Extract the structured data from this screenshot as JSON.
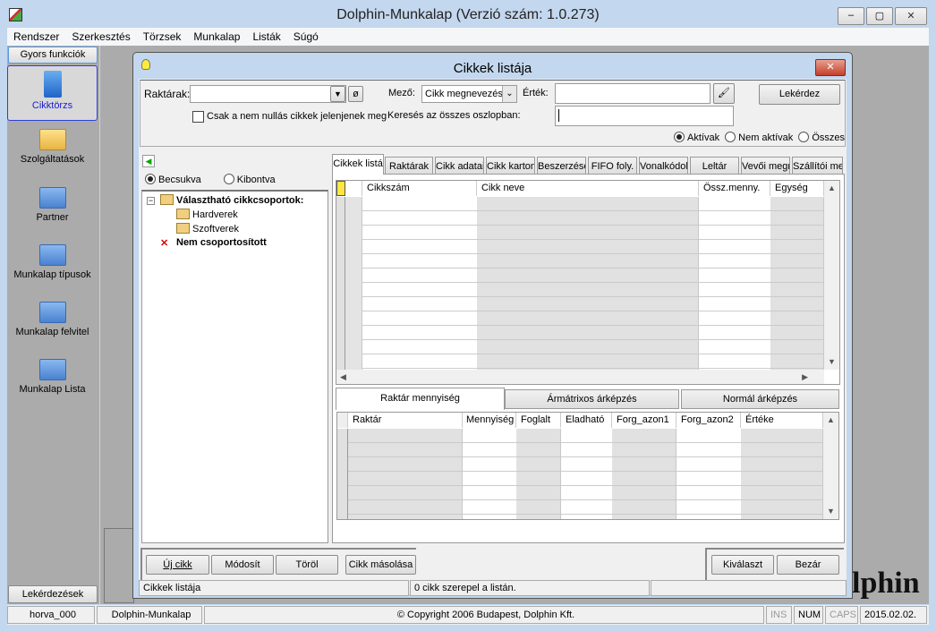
{
  "window": {
    "title": "Dolphin-Munkalap  (Verzió szám: 1.0.273)"
  },
  "menu": [
    "Rendszer",
    "Szerkesztés",
    "Törzsek",
    "Munkalap",
    "Listák",
    "Súgó"
  ],
  "sidebar": {
    "header": "Gyors funkciók",
    "items": [
      {
        "label": "Cikktörzs",
        "active": true
      },
      {
        "label": "Szolgáltatások"
      },
      {
        "label": "Partner"
      },
      {
        "label": "Munkalap típusok"
      },
      {
        "label": "Munkalap felvitel"
      },
      {
        "label": "Munkalap Lista"
      }
    ],
    "footer": "Lekérdezések"
  },
  "dialog": {
    "title": "Cikkek listája",
    "filters": {
      "raktarak_label": "Raktárak:",
      "raktarak_value": "",
      "clear_symbol": "ø",
      "nonzero_label": "Csak a nem nullás cikkek jelenjenek meg",
      "nonzero_checked": false,
      "mezo_label": "Mező:",
      "mezo_value": "Cikk megnevezése",
      "ertek_label": "Érték:",
      "ertek_value": "",
      "search_all_label": "Keresés az összes oszlopban:",
      "search_all_value": "",
      "query_button": "Lekérdez",
      "status_options": [
        "Aktívak",
        "Nem aktívak",
        "Összes"
      ],
      "status_selected": "Aktívak"
    },
    "tree": {
      "mode_options": [
        "Becsukva",
        "Kibontva"
      ],
      "mode_selected": "Becsukva",
      "root": "Választható cikkcsoportok:",
      "children": [
        "Hardverek",
        "Szoftverek"
      ],
      "ungrouped": "Nem csoportosított"
    },
    "tabs": [
      "Cikkek listá",
      "Raktárak",
      "Cikk adatai",
      "Cikk karton",
      "Beszerzése",
      "FIFO foly.",
      "Vonalkódok",
      "Leltár",
      "Vevői megr",
      "Szállítói meg"
    ],
    "grid": {
      "columns": [
        "Cikkszám",
        "Cikk neve",
        "Össz.menny.",
        "Egység"
      ],
      "rows": []
    },
    "lower_tabs": [
      "Raktár mennyiség",
      "Ármátrixos árképzés",
      "Normál árképzés"
    ],
    "lower_grid": {
      "columns": [
        "Raktár",
        "Mennyiség",
        "Foglalt",
        "Eladható",
        "Forg_azon1",
        "Forg_azon2",
        "Értéke"
      ],
      "rows": []
    },
    "buttons": {
      "new": "Új cikk",
      "edit": "Módosít",
      "delete": "Töröl",
      "copy": "Cikk másolása",
      "select": "Kiválaszt",
      "close": "Bezár"
    },
    "status": {
      "left": "Cikkek listája",
      "count": "0  cikk szerepel a listán.",
      "right": ""
    }
  },
  "statusbar": {
    "user": "horva_000",
    "app": "Dolphin-Munkalap",
    "copyright": "© Copyright 2006 Budapest, Dolphin Kft.",
    "ins": "INS",
    "num": "NUM",
    "caps": "CAPS",
    "date": "2015.02.02."
  },
  "logo_text": "lphin"
}
